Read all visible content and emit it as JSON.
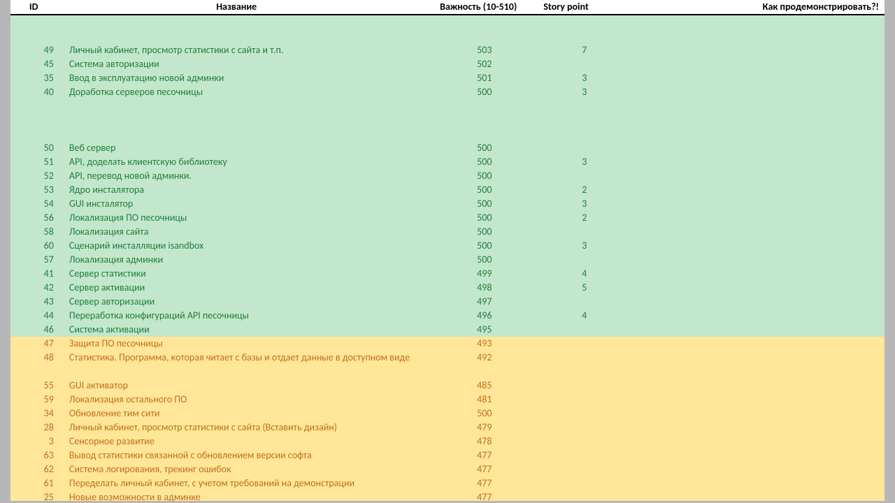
{
  "columns": {
    "id": "ID",
    "name": "Название",
    "importance": "Важность (10-510)",
    "story_point": "Story point",
    "demo": "Как продемонстрировать?!"
  },
  "rows": [
    {
      "type": "spacer",
      "bg": "green"
    },
    {
      "type": "spacer",
      "bg": "green"
    },
    {
      "id": "49",
      "name": "Личный кабинет, просмотр статистики с сайта и т.п.",
      "importance": "503",
      "sp": "7",
      "bg": "green"
    },
    {
      "id": "45",
      "name": "Система авторизации",
      "importance": "502",
      "sp": "",
      "bg": "green"
    },
    {
      "id": "35",
      "name": "Ввод в эксплуатацию новой админки",
      "importance": "501",
      "sp": "3",
      "bg": "green"
    },
    {
      "id": "40",
      "name": "Доработка серверов песочницы",
      "importance": "500",
      "sp": "3",
      "bg": "green"
    },
    {
      "type": "spacer",
      "bg": "green"
    },
    {
      "type": "spacer",
      "bg": "green"
    },
    {
      "type": "spacer",
      "bg": "green"
    },
    {
      "id": "50",
      "name": "Веб сервер",
      "importance": "500",
      "sp": "",
      "bg": "green"
    },
    {
      "id": "51",
      "name": "API, доделать клиентскую библиотеку",
      "importance": "500",
      "sp": "3",
      "bg": "green"
    },
    {
      "id": "52",
      "name": "API, перевод новой админки.",
      "importance": "500",
      "sp": "",
      "bg": "green"
    },
    {
      "id": "53",
      "name": "Ядро инсталятора",
      "importance": "500",
      "sp": "2",
      "bg": "green"
    },
    {
      "id": "54",
      "name": "GUI инсталятор",
      "importance": "500",
      "sp": "3",
      "bg": "green"
    },
    {
      "id": "56",
      "name": "Локализация ПО песочницы",
      "importance": "500",
      "sp": "2",
      "bg": "green"
    },
    {
      "id": "58",
      "name": "Локализация сайта",
      "importance": "500",
      "sp": "",
      "bg": "green"
    },
    {
      "id": "60",
      "name": "Сценарий инсталляции isandbox",
      "importance": "500",
      "sp": "3",
      "bg": "green"
    },
    {
      "id": "57",
      "name": "Локализация админки",
      "importance": "500",
      "sp": "",
      "bg": "green"
    },
    {
      "id": "41",
      "name": "Сервер статистики",
      "importance": "499",
      "sp": "4",
      "bg": "green"
    },
    {
      "id": "42",
      "name": "Сервер активации",
      "importance": "498",
      "sp": "5",
      "bg": "green"
    },
    {
      "id": "43",
      "name": "Сервер авторизации",
      "importance": "497",
      "sp": "",
      "bg": "green"
    },
    {
      "id": "44",
      "name": "Переработка конфигураций API песочницы",
      "importance": "496",
      "sp": "4",
      "bg": "green"
    },
    {
      "id": "46",
      "name": "Система активации",
      "importance": "495",
      "sp": "",
      "bg": "green"
    },
    {
      "id": "47",
      "name": "Защита ПО песочницы",
      "importance": "493",
      "sp": "",
      "bg": "yellow"
    },
    {
      "id": "48",
      "name": "Статистика. Программа, которая читает с базы и отдает данные в доступном виде",
      "importance": "492",
      "sp": "",
      "bg": "yellow",
      "wrap": true
    },
    {
      "id": "55",
      "name": "GUI активатор",
      "importance": "485",
      "sp": "",
      "bg": "yellow"
    },
    {
      "id": "59",
      "name": "Локализация остального ПО",
      "importance": "481",
      "sp": "",
      "bg": "yellow"
    },
    {
      "id": "34",
      "name": "Обновление тим сити",
      "importance": "500",
      "sp": "",
      "bg": "yellow"
    },
    {
      "id": "28",
      "name": "Личный кабинет, просмотр статистики с сайта (Вставить дизайн)",
      "importance": "479",
      "sp": "",
      "bg": "yellow"
    },
    {
      "id": "3",
      "name": "Сенсорное развитие",
      "importance": "478",
      "sp": "",
      "bg": "yellow"
    },
    {
      "id": "63",
      "name": "Вывод статистики связанной с обновлением версии софта",
      "importance": "477",
      "sp": "",
      "bg": "yellow"
    },
    {
      "id": "62",
      "name": "Система логирования, трекинг ошибок",
      "importance": "477",
      "sp": "",
      "bg": "yellow"
    },
    {
      "id": "61",
      "name": "Переделать личный кабинет, с учетом требований на демонстрации",
      "importance": "477",
      "sp": "",
      "bg": "yellow"
    },
    {
      "id": "25",
      "name": "Новые возможности в админке",
      "importance": "477",
      "sp": "",
      "bg": "yellow"
    }
  ]
}
